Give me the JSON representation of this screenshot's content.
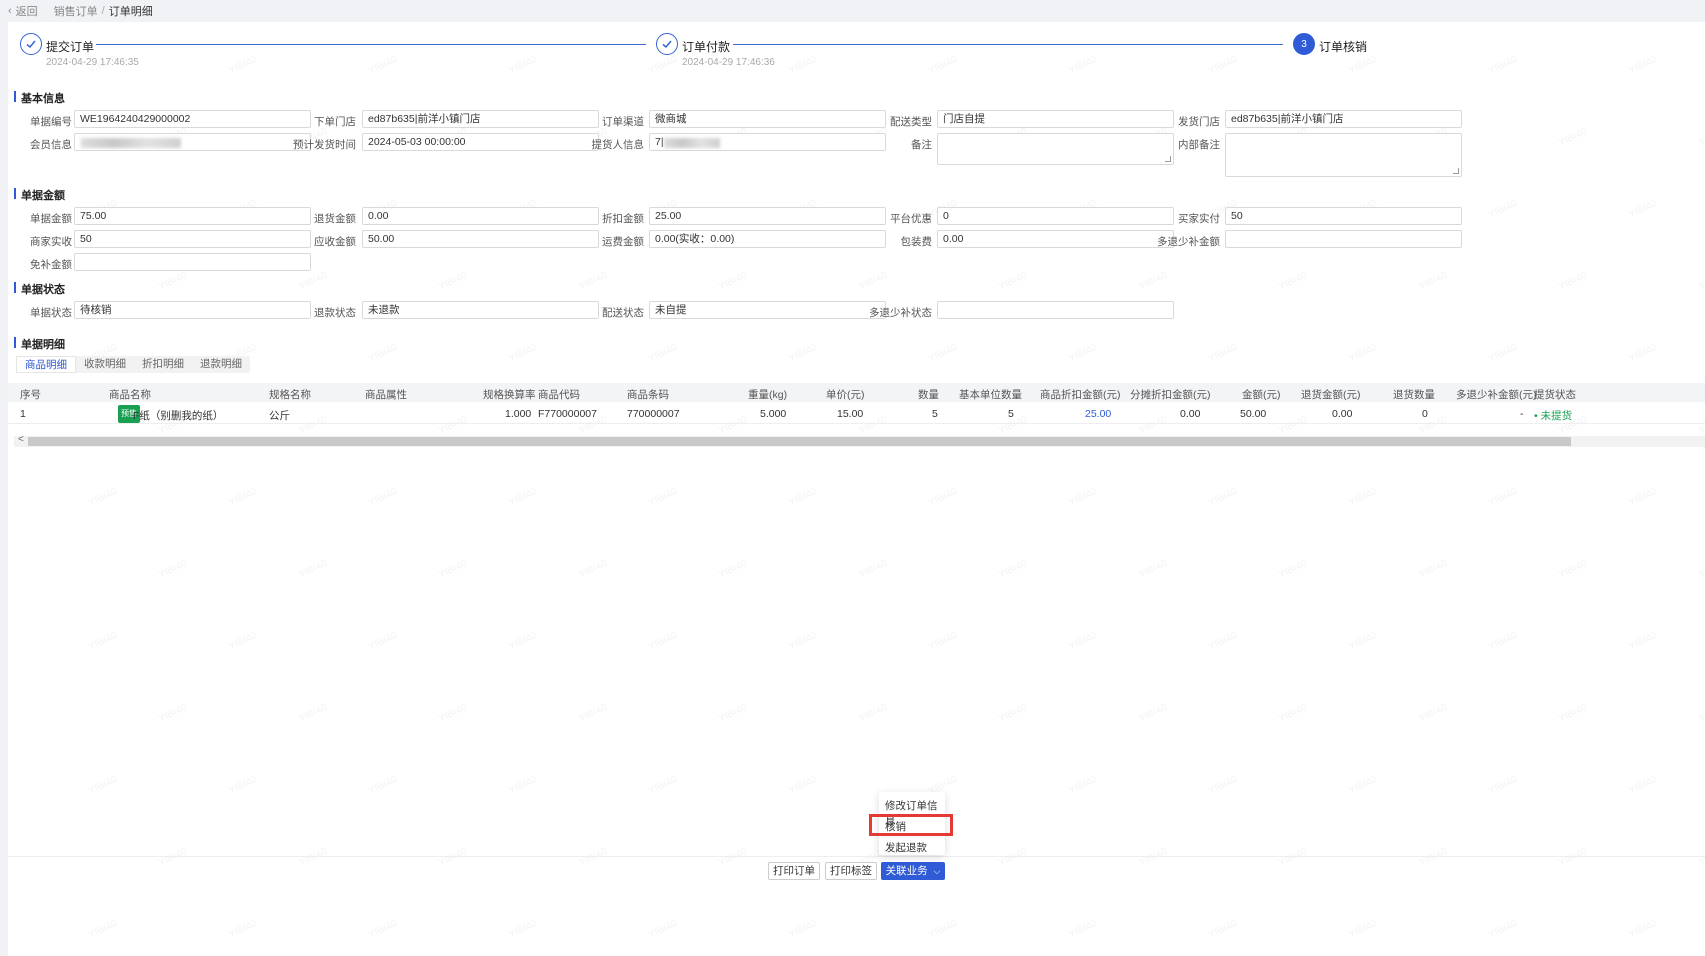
{
  "breadcrumb": {
    "back": "返回",
    "parent": "销售订单",
    "separator": "/",
    "current": "订单明细"
  },
  "steps": [
    {
      "title": "提交订单",
      "time": "2024-04-29 17:46:35",
      "number": "",
      "status": "done"
    },
    {
      "title": "订单付款",
      "time": "2024-04-29 17:46:36",
      "number": "",
      "status": "done"
    },
    {
      "title": "订单核销",
      "time": "",
      "number": "3",
      "status": "active"
    }
  ],
  "sections": {
    "basic": "基本信息",
    "amount": "单据金额",
    "status": "单据状态",
    "detail": "单据明细"
  },
  "basic": {
    "doc_no_label": "单据编号",
    "doc_no": "WE1964240429000002",
    "order_store_label": "下单门店",
    "order_store": "ed87b635|前洋小镇门店",
    "channel_label": "订单渠道",
    "channel": "微商城",
    "delivery_type_label": "配送类型",
    "delivery_type": "门店自提",
    "ship_store_label": "发货门店",
    "ship_store": "ed87b635|前洋小镇门店",
    "member_label": "会员信息",
    "member": "",
    "expected_ship_label": "预计发货时间",
    "expected_ship": "2024-05-03 00:00:00",
    "picker_label": "提货人信息",
    "picker": "7|",
    "remark_label": "备注",
    "remark": "",
    "internal_remark_label": "内部备注",
    "internal_remark": ""
  },
  "amount": {
    "doc_amount_label": "单据金额",
    "doc_amount": "75.00",
    "return_amount_label": "退货金额",
    "return_amount": "0.00",
    "discount_label": "折扣金额",
    "discount": "25.00",
    "platform_label": "平台优惠",
    "platform": "0",
    "buyer_paid_label": "买家实付",
    "buyer_paid": "50",
    "merchant_label": "商家实收",
    "merchant": "50",
    "receivable_label": "应收金额",
    "receivable": "50.00",
    "freight_label": "运费金额",
    "freight": "0.00(实收：0.00)",
    "packing_label": "包装费",
    "packing": "0.00",
    "refund_diff_label": "多退少补金额",
    "refund_diff": "",
    "free_label": "免补金额",
    "free": ""
  },
  "status": {
    "doc_status_label": "单据状态",
    "doc_status": "待核销",
    "refund_status_label": "退款状态",
    "refund_status": "未退款",
    "delivery_status_label": "配送状态",
    "delivery_status": "未自提",
    "diff_status_label": "多退少补状态",
    "diff_status": ""
  },
  "tabs": [
    "商品明细",
    "收款明细",
    "折扣明细",
    "退款明细"
  ],
  "table": {
    "headers": [
      "序号",
      "商品名称",
      "规格名称",
      "商品属性",
      "规格换算率",
      "商品代码",
      "商品条码",
      "重量(kg)",
      "单价(元)",
      "数量",
      "基本单位数量",
      "商品折扣金额(元)",
      "分摊折扣金额(元)",
      "金额(元)",
      "退货金额(元)",
      "退货数量",
      "多退少补金额(元)",
      "提货状态"
    ],
    "rows": [
      {
        "no": "1",
        "tag": "预售",
        "name": "F纸（别删我的纸）",
        "spec": "公斤",
        "attr": "",
        "rate": "1.000",
        "code": "F770000007",
        "barcode": "770000007",
        "weight": "5.000",
        "price": "15.00",
        "qty": "5",
        "base_qty": "5",
        "goods_discount": "25.00",
        "alloc_discount": "0.00",
        "amount": "50.00",
        "return_amount": "0.00",
        "return_qty": "0",
        "diff_amount": "-",
        "pickup": "• 未提货"
      }
    ]
  },
  "buttons": {
    "print_order": "打印订单",
    "print_label": "打印标签",
    "related": "关联业务",
    "related_arrow": "⌵"
  },
  "dropdown": [
    "修改订单信息",
    "核销",
    "发起退款"
  ],
  "watermark": "YIBI40"
}
